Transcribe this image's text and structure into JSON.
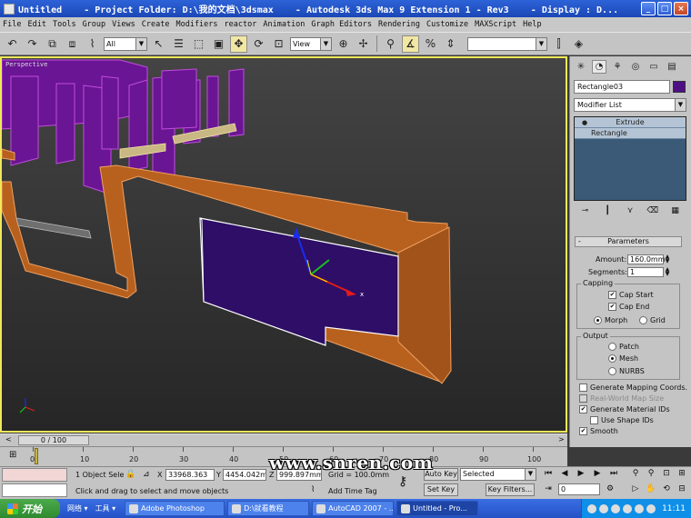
{
  "titlebar": {
    "title": "Untitled    - Project Folder: D:\\我的文档\\3dsmax    - Autodesk 3ds Max 9 Extension 1 - Rev3    - Display : D...",
    "minimize": "_",
    "maximize": "□",
    "close": "×"
  },
  "menu": [
    "File",
    "Edit",
    "Tools",
    "Group",
    "Views",
    "Create",
    "Modifiers",
    "reactor",
    "Animation",
    "Graph Editors",
    "Rendering",
    "Customize",
    "MAXScript",
    "Help"
  ],
  "toolbar": {
    "selection_filter": "All",
    "ref_coord": "View",
    "named_selection": ""
  },
  "viewport": {
    "label": "Perspective"
  },
  "command_panel": {
    "object_name": "Rectangle03",
    "object_color": "#4f0f84",
    "modifier_list": "Modifier List",
    "stack": [
      "Extrude",
      "Rectangle"
    ],
    "rollout_title": "Parameters",
    "amount_label": "Amount:",
    "amount_value": "160.0mm",
    "segments_label": "Segments:",
    "segments_value": "1",
    "capping_title": "Capping",
    "cap_start": "Cap Start",
    "cap_end": "Cap End",
    "morph": "Morph",
    "grid": "Grid",
    "output_title": "Output",
    "patch": "Patch",
    "mesh": "Mesh",
    "nurbs": "NURBS",
    "gen_mapping": "Generate Mapping Coords.",
    "real_world": "Real-World Map Size",
    "gen_material_ids": "Generate Material IDs",
    "use_shape_ids": "Use Shape IDs",
    "smooth": "Smooth"
  },
  "timeline": {
    "frame_display": "0 / 100",
    "ticks": [
      "0",
      "10",
      "20",
      "30",
      "40",
      "50",
      "60",
      "70",
      "80",
      "90",
      "100"
    ]
  },
  "status": {
    "selection_count": "1 Object Sele",
    "prompt": "Click and drag to select and move objects",
    "x_label": "X",
    "x_value": "33968.363",
    "y_label": "Y",
    "y_value": "4454.042m",
    "z_label": "Z",
    "z_value": "999.897mm",
    "grid": "Grid = 100.0mm",
    "add_time_tag": "Add Time Tag",
    "auto_key": "Auto Key",
    "set_key": "Set Key",
    "selected": "Selected",
    "key_filters": "Key Filters...",
    "frame_value": "0"
  },
  "watermark": "www.snren.com",
  "taskbar": {
    "start": "开始",
    "quick_launch": [
      "网络 ▾",
      "工具 ▾"
    ],
    "tasks": [
      "Adobe Photoshop",
      "D:\\就看教程",
      "AutoCAD 2007 - ...",
      "Untitled    - Pro..."
    ],
    "clock": "11:11"
  }
}
